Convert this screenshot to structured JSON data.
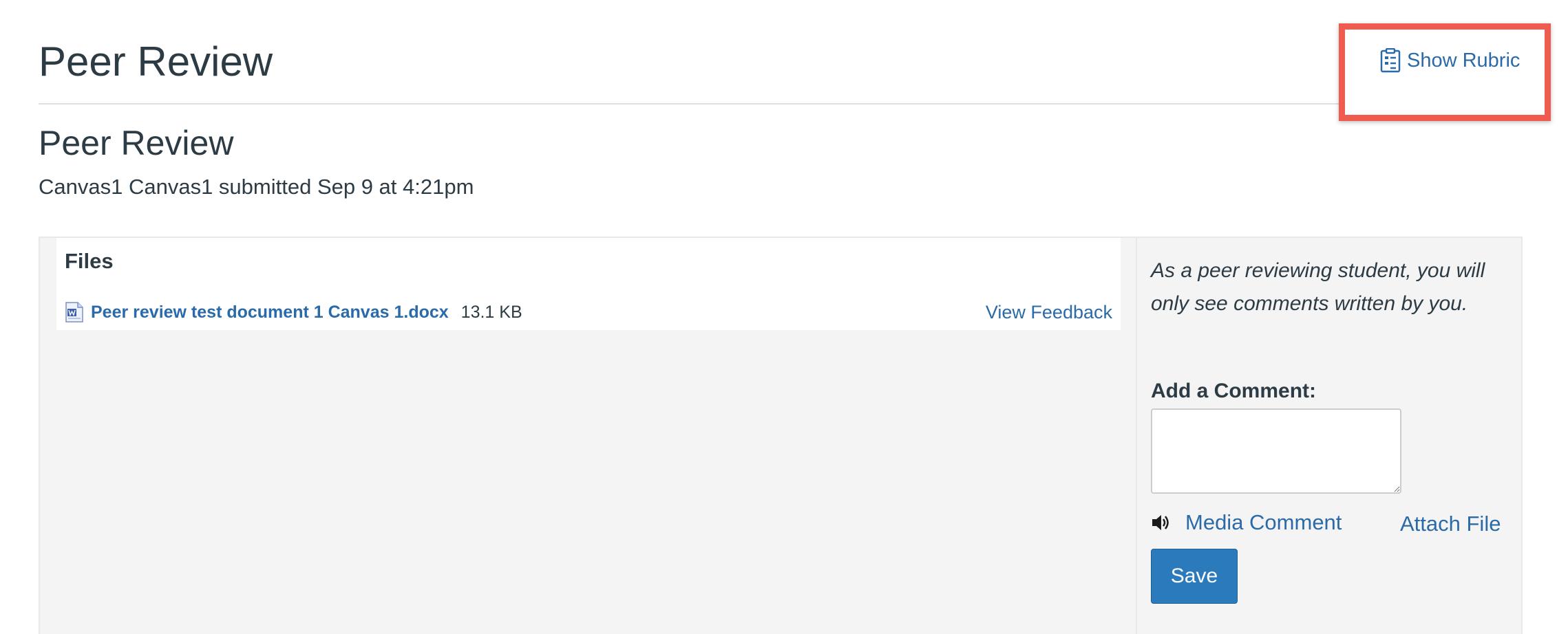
{
  "header": {
    "title": "Peer Review",
    "show_rubric_label": "Show Rubric"
  },
  "submission": {
    "title": "Peer Review",
    "submitted_text": "Canvas1 Canvas1 submitted Sep 9 at 4:21pm"
  },
  "files": {
    "title": "Files",
    "items": [
      {
        "name": "Peer review test document 1 Canvas 1.docx",
        "size": "13.1 KB",
        "action_label": "View Feedback"
      }
    ]
  },
  "comments": {
    "peer_note": "As a peer reviewing student, you will only see comments written by you.",
    "add_label": "Add a Comment:",
    "input_value": "",
    "media_comment_label": "Media Comment",
    "attach_file_label": "Attach File",
    "save_label": "Save"
  },
  "colors": {
    "link": "#2b6aa8",
    "highlight": "#ef5b4e",
    "save_button": "#2b7abc",
    "panel_bg": "#f4f4f4"
  },
  "icons": {
    "rubric": "clipboard-icon",
    "file": "word-document-icon",
    "media": "speaker-icon"
  }
}
